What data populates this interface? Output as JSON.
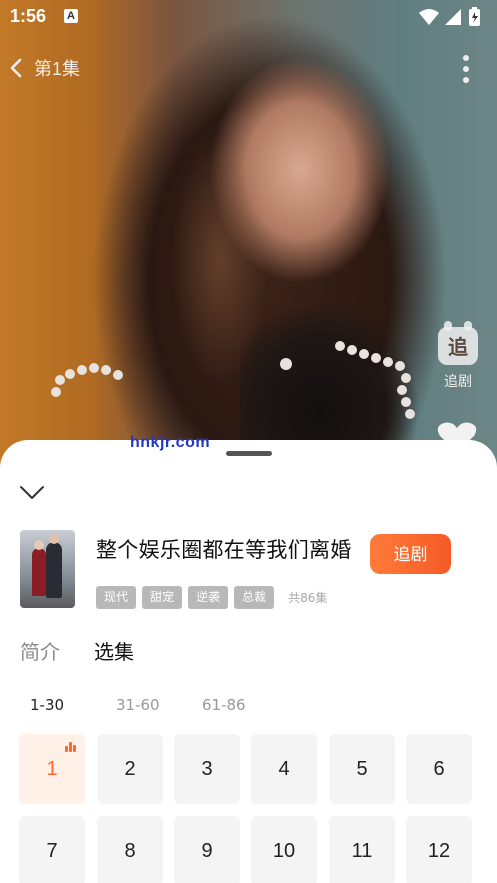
{
  "status_bar": {
    "time": "1:56",
    "notification_glyph": "A"
  },
  "topnav": {
    "episode_label": "第1集",
    "back_icon": "chevron-left-icon",
    "more_icon": "more-vert-icon"
  },
  "side_actions": {
    "follow_glyph": "追",
    "follow_label": "追剧"
  },
  "watermark": "hnkjr.com",
  "sheet": {
    "collapse_icon": "chevron-down-icon",
    "title": "整个娱乐圈都在等我们离婚",
    "follow_button": "追剧",
    "tags": [
      "现代",
      "甜宠",
      "逆袭",
      "总裁"
    ],
    "episode_count": "共86集",
    "tabs": [
      {
        "label": "简介",
        "active": false
      },
      {
        "label": "选集",
        "active": true
      }
    ],
    "ranges": [
      {
        "label": "1-30",
        "active": true
      },
      {
        "label": "31-60",
        "active": false
      },
      {
        "label": "61-86",
        "active": false
      }
    ],
    "episodes": [
      "1",
      "2",
      "3",
      "4",
      "5",
      "6",
      "7",
      "8",
      "9",
      "10",
      "11",
      "12"
    ],
    "current_episode": "1"
  },
  "colors": {
    "accent": "#f55a26",
    "accent_light": "#fff0e8",
    "tag_bg": "#b8b8b8"
  }
}
